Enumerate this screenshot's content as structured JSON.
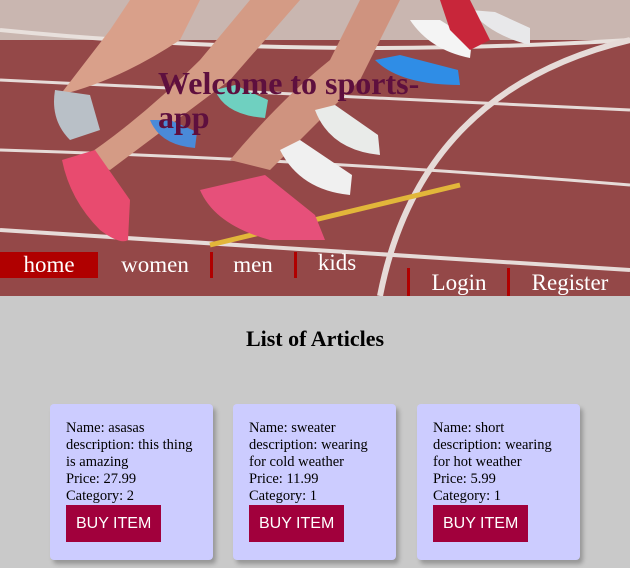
{
  "hero": {
    "title": "Welcome to sports-app"
  },
  "nav": {
    "items": [
      "home",
      "women",
      "men",
      "kids"
    ],
    "active": "home",
    "auth": [
      "Login",
      "Register"
    ]
  },
  "main": {
    "title": "List of Articles"
  },
  "articles": [
    {
      "name": "Name: asasas",
      "description": "description: this thing is amazing",
      "price": "Price: 27.99",
      "category": "Category: 2",
      "button": "BUY ITEM"
    },
    {
      "name": "Name: sweater",
      "description": "description: wearing for cold weather",
      "price": "Price: 11.99",
      "category": "Category: 1",
      "button": "BUY ITEM"
    },
    {
      "name": "Name: short",
      "description": "description: wearing for hot weather",
      "price": "Price: 5.99",
      "category": "Category: 1",
      "button": "BUY ITEM"
    }
  ],
  "colors": {
    "accent": "#b00000",
    "button": "#a1003c",
    "card": "#ccccff",
    "title": "#5e0f3e",
    "background": "#c9c9c9"
  }
}
